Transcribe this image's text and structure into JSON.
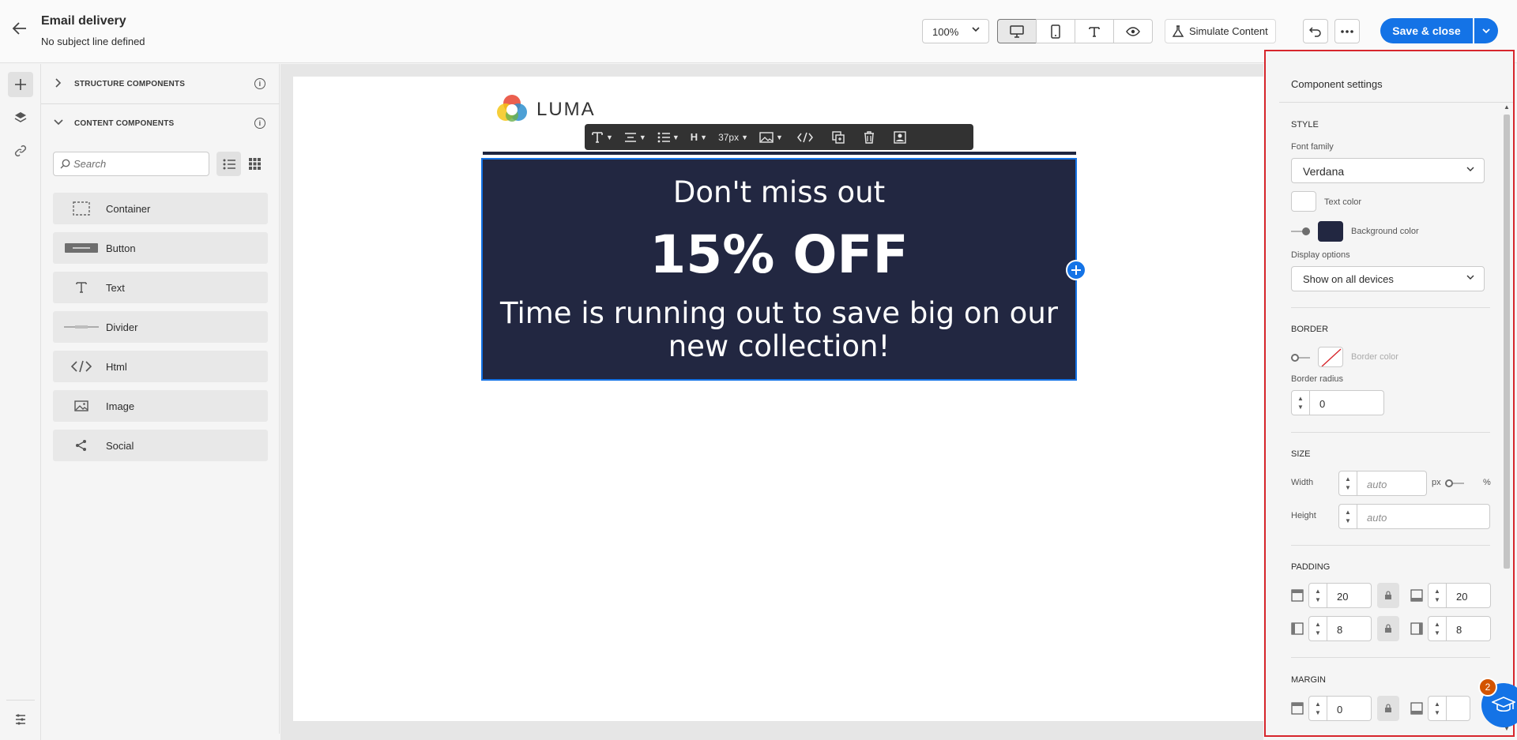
{
  "header": {
    "title": "Email delivery",
    "subtitle": "No subject line defined",
    "zoom": "100%",
    "simulate_label": "Simulate Content",
    "save_label": "Save & close"
  },
  "components_panel": {
    "structure_label": "STRUCTURE COMPONENTS",
    "content_label": "CONTENT COMPONENTS",
    "search_placeholder": "Search",
    "items": [
      {
        "label": "Container",
        "icon": "container-icon"
      },
      {
        "label": "Button",
        "icon": "button-icon"
      },
      {
        "label": "Text",
        "icon": "text-icon"
      },
      {
        "label": "Divider",
        "icon": "divider-icon"
      },
      {
        "label": "Html",
        "icon": "html-icon"
      },
      {
        "label": "Image",
        "icon": "image-icon"
      },
      {
        "label": "Social",
        "icon": "social-icon"
      }
    ]
  },
  "canvas": {
    "logo_text": "LUMA",
    "toolbar_font_size": "37px",
    "hero_line1": "Don't miss out",
    "hero_line2": "15% OFF",
    "hero_line3": "Time is running out to save big on our new collection!",
    "hero_bg": "#222741"
  },
  "settings": {
    "title": "Component settings",
    "style_heading": "STYLE",
    "font_family_label": "Font family",
    "font_family_value": "Verdana",
    "text_color_label": "Text color",
    "bg_color_label": "Background color",
    "display_options_label": "Display options",
    "display_options_value": "Show on all devices",
    "border_heading": "BORDER",
    "border_color_label": "Border color",
    "border_radius_label": "Border radius",
    "border_radius_value": "0",
    "size_heading": "SIZE",
    "width_label": "Width",
    "width_placeholder": "auto",
    "height_label": "Height",
    "height_placeholder": "auto",
    "unit_px": "px",
    "unit_pct": "%",
    "padding_heading": "PADDING",
    "padding_top": "20",
    "padding_bottom": "20",
    "padding_left": "8",
    "padding_right": "8",
    "margin_heading": "MARGIN",
    "margin_top": "0"
  },
  "help": {
    "badge_count": "2"
  }
}
